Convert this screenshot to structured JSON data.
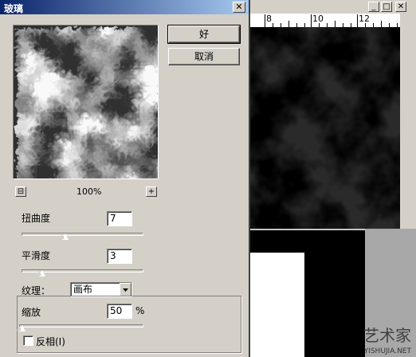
{
  "dialog": {
    "title": "玻璃",
    "ok_label": "好",
    "cancel_label": "取消",
    "zoom_value": "100%",
    "zoom_out_glyph": "⊟",
    "zoom_in_glyph": "+",
    "close_glyph": "✕",
    "distortion": {
      "label": "扭曲度",
      "value": "7",
      "level": 0.35
    },
    "smoothness": {
      "label": "平滑度",
      "value": "3",
      "level": 0.15
    },
    "texture": {
      "label": "纹理：",
      "selected": "画布"
    },
    "scaling": {
      "label": "缩放",
      "value": "50",
      "unit": "%",
      "level": 0.0
    },
    "invert": {
      "label": "反相(I)",
      "checked": false
    }
  },
  "document": {
    "ruler_labels": [
      "8",
      "10",
      "12"
    ],
    "minimize_glyph": "_",
    "maximize_glyph": "□",
    "close_glyph": "✕"
  },
  "watermark": {
    "main": "艺术家",
    "sub": "YISHUJIA.NET"
  }
}
